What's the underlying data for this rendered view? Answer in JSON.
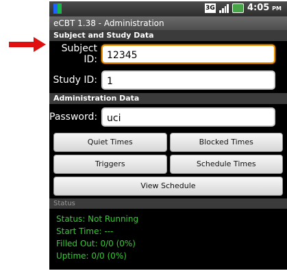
{
  "annotation": {
    "arrow_color": "#e01010"
  },
  "statusbar": {
    "network_label": "3G",
    "time": "4:05",
    "ampm": "PM",
    "icons": [
      "app-icon",
      "3g-icon",
      "signal-icon",
      "battery-icon"
    ]
  },
  "app": {
    "title": "eCBT 1.38 - Administration"
  },
  "subject_section": {
    "header": "Subject and Study Data",
    "subject_label": "Subject ID:",
    "subject_value": "12345",
    "study_label": "Study ID:",
    "study_value": "1"
  },
  "admin_section": {
    "header": "Administration Data",
    "password_label": "Password:",
    "password_value": "uci",
    "buttons": {
      "quiet_times": "Quiet Times",
      "blocked_times": "Blocked Times",
      "triggers": "Triggers",
      "schedule_times": "Schedule Times",
      "view_schedule": "View Schedule"
    }
  },
  "status_section": {
    "header": "Status",
    "status": "Status:  Not Running",
    "start_time": "Start Time:  ---",
    "filled_out": "Filled Out:  0/0 (0%)",
    "uptime": "Uptime:  0/0 (0%)"
  },
  "colors": {
    "status_green": "#33cc33",
    "focus_orange": "#f29400"
  }
}
